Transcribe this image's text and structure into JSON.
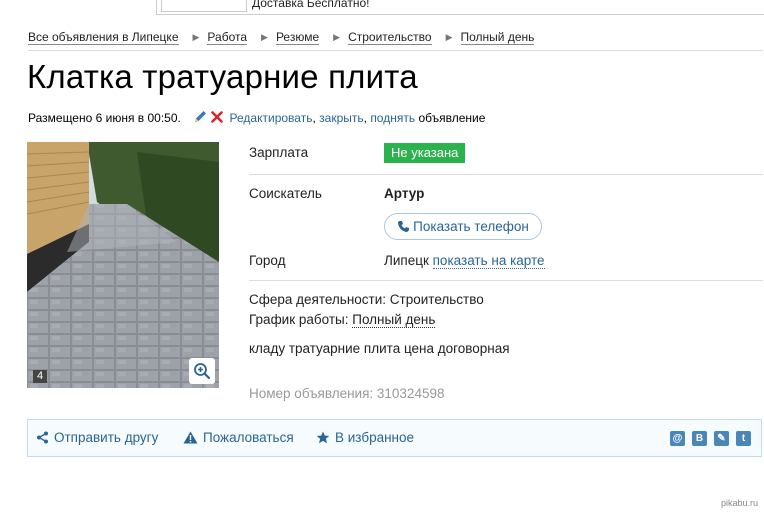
{
  "banner": {
    "text": "Доставка Бесплатно!"
  },
  "breadcrumbs": [
    "Все объявления в Липецке",
    "Работа",
    "Резюме",
    "Строительство",
    "Полный день"
  ],
  "title": "Клатка тратуарние плита",
  "posted": {
    "text": "Размещено 6 июня в 00:50.",
    "edit": "Редактировать",
    "comma1": ",",
    "close": "закрыть",
    "comma2": ",",
    "raise": "поднять",
    "suffix": "объявление"
  },
  "photo": {
    "count": "4"
  },
  "fields": {
    "salary_label": "Зарплата",
    "salary_value": "Не указана",
    "applicant_label": "Соискатель",
    "applicant_value": "Артур",
    "phone_button": "Показать телефон",
    "city_label": "Город",
    "city_value": "Липецк",
    "map_link": "показать на карте"
  },
  "details": {
    "sphere_label": "Сфера деятельности:",
    "sphere_value": "Строительство",
    "schedule_label": "График работы:",
    "schedule_value": "Полный день",
    "description": "кладу тратуарние плита цена договорная"
  },
  "ad_number": "Номер объявления: 310324598",
  "actions": {
    "send": "Отправить другу",
    "report": "Пожаловаться",
    "favorite": "В избранное"
  },
  "social": [
    "@",
    "B",
    "✎",
    "t"
  ],
  "watermark": "pikabu.ru",
  "colors": {
    "accent": "#2a6496",
    "salary_bg": "#2bb24c",
    "close_red": "#d9262b"
  }
}
